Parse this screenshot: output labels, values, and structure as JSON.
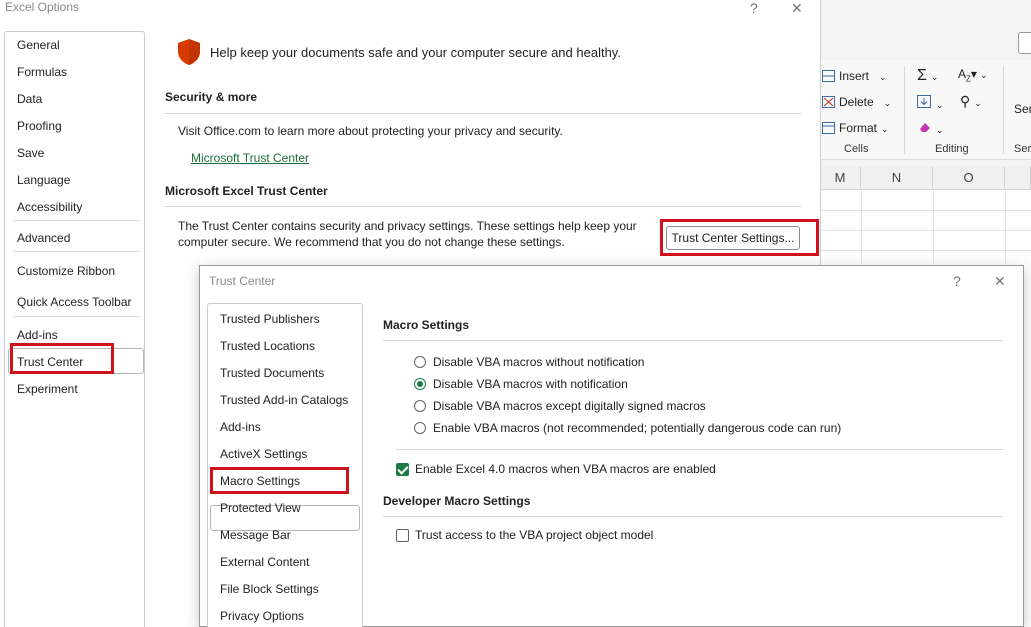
{
  "excel": {
    "ribbon": {
      "insert": "Insert",
      "delete": "Delete",
      "format": "Format",
      "cells_group": "Cells",
      "editing_group": "Editing",
      "sensitivity_partial": "Ser",
      "sensitivity_group_partial": "Ser"
    },
    "columns": [
      "M",
      "N",
      "O"
    ]
  },
  "options_dialog": {
    "title": "Excel Options",
    "help": "?",
    "close": "✕",
    "nav": [
      "General",
      "Formulas",
      "Data",
      "Proofing",
      "Save",
      "Language",
      "Accessibility",
      "Advanced",
      "Customize Ribbon",
      "Quick Access Toolbar",
      "Add-ins",
      "Trust Center",
      "Experiment"
    ],
    "hero_text": "Help keep your documents safe and your computer secure and healthy.",
    "security_title": "Security & more",
    "security_text": "Visit Office.com to learn more about protecting your privacy and security.",
    "trust_link": "Microsoft Trust Center",
    "tc_title": "Microsoft Excel Trust Center",
    "tc_text": "The Trust Center contains security and privacy settings. These settings help keep your computer secure. We recommend that you do not change these settings.",
    "tc_button": "Trust Center Settings..."
  },
  "trust_center": {
    "title": "Trust Center",
    "help": "?",
    "close": "✕",
    "nav": [
      "Trusted Publishers",
      "Trusted Locations",
      "Trusted Documents",
      "Trusted Add-in Catalogs",
      "Add-ins",
      "ActiveX Settings",
      "Macro Settings",
      "Protected View",
      "Message Bar",
      "External Content",
      "File Block Settings",
      "Privacy Options"
    ],
    "macro_title": "Macro Settings",
    "radios": [
      {
        "label": "Disable VBA macros without notification",
        "selected": false
      },
      {
        "label": "Disable VBA macros with notification",
        "selected": true
      },
      {
        "label": "Disable VBA macros except digitally signed macros",
        "selected": false
      },
      {
        "label": "Enable VBA macros (not recommended; potentially dangerous code can run)",
        "selected": false
      }
    ],
    "excel4_checkbox": {
      "label": "Enable Excel 4.0 macros when VBA macros are enabled",
      "checked": true
    },
    "dev_title": "Developer Macro Settings",
    "vba_checkbox": {
      "label": "Trust access to the VBA project object model",
      "checked": false
    }
  },
  "colors": {
    "highlight_red": "#d0121b",
    "accent_green": "#1d7a45",
    "link_green": "#1b6e3a",
    "shield_orange": "#d83b01"
  }
}
